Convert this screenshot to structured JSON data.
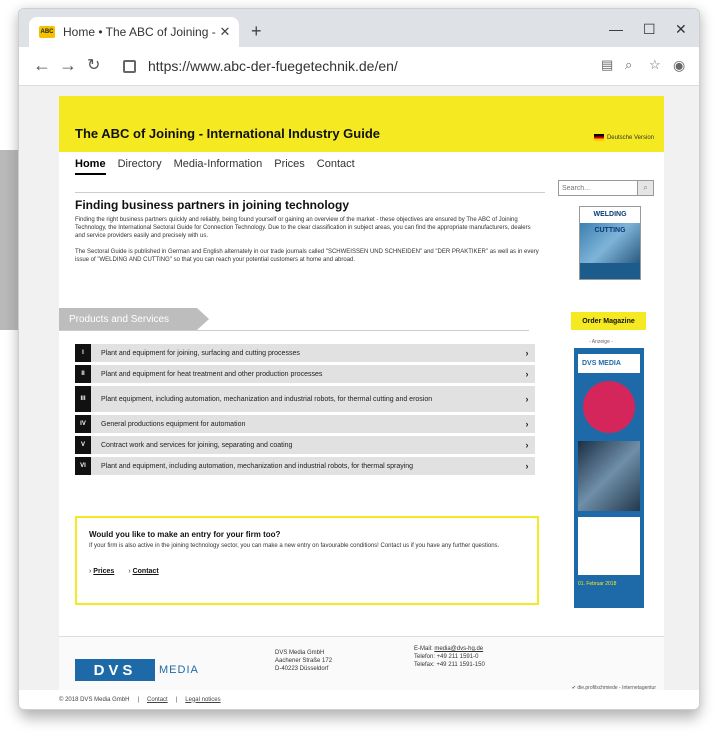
{
  "browser": {
    "tab_title": "Home • The ABC of Joining - Inte",
    "favicon_text": "ABC",
    "url": "https://www.abc-der-fuegetechnik.de/en/"
  },
  "header": {
    "title": "The ABC of Joining - International Industry Guide",
    "lang": "Deutsche Version"
  },
  "nav": {
    "items": [
      "Home",
      "Directory",
      "Media-Information",
      "Prices",
      "Contact"
    ],
    "search_placeholder": "Search..."
  },
  "intro": {
    "heading": "Finding business partners in joining technology",
    "p1": "Finding the right business partners quickly and reliably, being found yourself or gaining an overview of the market - these objectives are ensured by The ABC of Joining Technology, the International Sectoral Guide for Connection Technology. Due to the clear classification in subject areas, you can find the appropriate manufacturers, dealers and service providers easily and precisely with us.",
    "p2": "The Sectoral Guide is published in German and English alternately in our trade journals called \"SCHWEISSEN UND SCHNEIDEN\" and \"DER PRAKTIKER\" as well as in every issue of \"WELDING AND CUTTING\" so that you can reach your potential customers at home and abroad."
  },
  "sidebar": {
    "magazine_title": "WELDING CUTTING",
    "order_label": "Order Magazine",
    "anzeige": "- Anzeige -",
    "ad_logo": "DVS MEDIA",
    "ad_date": "01. Februar 2018"
  },
  "products": {
    "section_title": "Products and Services",
    "items": [
      {
        "num": "I",
        "label": "Plant and equipment for joining, surfacing and cutting processes"
      },
      {
        "num": "II",
        "label": "Plant and equipment for heat treatment and other production processes"
      },
      {
        "num": "III",
        "label": "Plant equipment, including automation, mechanization and industrial robots, for thermal cutting and erosion"
      },
      {
        "num": "IV",
        "label": "General productions equipment for automation"
      },
      {
        "num": "V",
        "label": "Contract work and services for joining, separating and coating"
      },
      {
        "num": "VI",
        "label": "Plant and equipment, including automation, mechanization and industrial robots, for thermal spraying"
      }
    ]
  },
  "entry": {
    "heading": "Would you like to make an entry for your firm too?",
    "text": "If your firm is also active in the joining technology sector, you can make a new entry on favourable conditions! Contact us if you have any further questions.",
    "link_prices": "Prices",
    "link_contact": "Contact"
  },
  "footer": {
    "logo_dvs": "DVS",
    "logo_media": "MEDIA",
    "address": [
      "DVS Media GmbH",
      "Aachener Straße 172",
      "D-40223 Düsseldorf"
    ],
    "email_label": "E-Mail:",
    "email": "media@dvs-hg.de",
    "phone": "Telefon: +49 211 1591-0",
    "fax": "Telefax: +49 211 1591-150",
    "credit": "✔ die.profilschmiede - Internetagentur",
    "copyright": "© 2018 DVS Media GmbH",
    "contact_link": "Contact",
    "legal_link": "Legal notices"
  }
}
